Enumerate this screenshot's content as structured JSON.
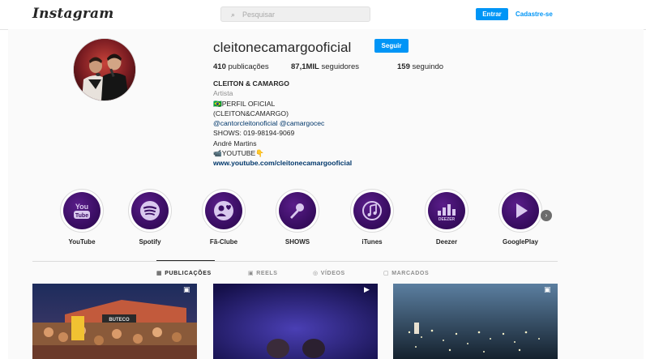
{
  "brand": {
    "logo": "Instagram"
  },
  "search": {
    "placeholder": "Pesquisar",
    "icon": "search-icon"
  },
  "auth": {
    "login_label": "Entrar",
    "signup_label": "Cadastre-se"
  },
  "colors": {
    "accent": "#0095f6",
    "highlight_purple": "#3a0e63",
    "link": "#00376b"
  },
  "profile": {
    "username": "cleitonecamargooficial",
    "follow_label": "Seguir",
    "stats": {
      "posts_value": "410",
      "posts_label": "publicações",
      "followers_value": "87,1MIL",
      "followers_label": "seguidores",
      "following_value": "159",
      "following_label": "seguindo"
    },
    "bio": {
      "name": "CLEITON & CAMARGO",
      "category": "Artista",
      "line1": "🇧🇷PERFIL OFICIAL",
      "line2": "(CLEITON&CAMARGO)",
      "mention1": "@cantorcleitonoficial",
      "mention2": "@camargocec",
      "line4": "SHOWS: 019-98194-9069",
      "line5": "André Martins",
      "line6": "📹YOUTUBE👇",
      "link": "www.youtube.com/cleitonecamargooficial"
    }
  },
  "highlights": [
    {
      "label": "YouTube",
      "icon": "youtube-icon"
    },
    {
      "label": "Spotify",
      "icon": "spotify-icon"
    },
    {
      "label": "Fã-Clube",
      "icon": "fan-club-icon"
    },
    {
      "label": "SHOWS",
      "icon": "microphone-icon"
    },
    {
      "label": "iTunes",
      "icon": "itunes-icon"
    },
    {
      "label": "Deezer",
      "icon": "deezer-icon"
    },
    {
      "label": "GooglePlay",
      "icon": "play-icon"
    }
  ],
  "tabs": [
    {
      "label": "PUBLICAÇÕES",
      "icon": "grid-icon",
      "active": true
    },
    {
      "label": "REELS",
      "icon": "reels-icon",
      "active": false
    },
    {
      "label": "VÍDEOS",
      "icon": "video-icon",
      "active": false
    },
    {
      "label": "MARCADOS",
      "icon": "tagged-icon",
      "active": false
    }
  ],
  "posts": [
    {
      "type": "reel",
      "icon": "reel-badge-icon"
    },
    {
      "type": "video",
      "icon": "video-badge-icon"
    },
    {
      "type": "reel",
      "icon": "reel-badge-icon"
    }
  ]
}
